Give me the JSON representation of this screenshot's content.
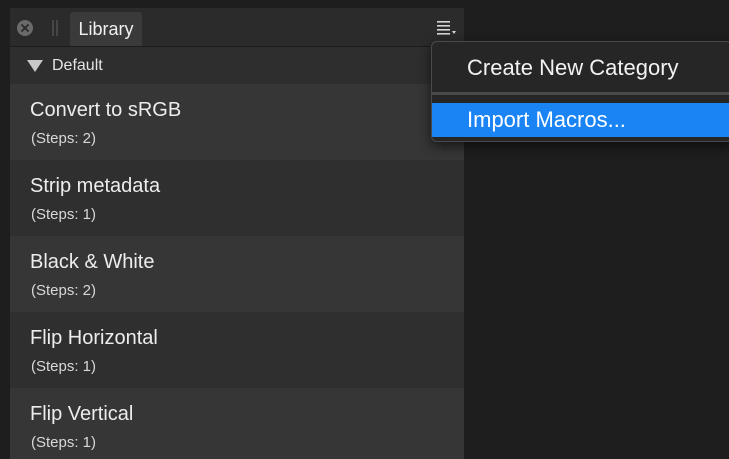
{
  "panel": {
    "tab_label": "Library",
    "category": "Default",
    "macros": [
      {
        "name": "Convert to sRGB",
        "steps": "(Steps: 2)"
      },
      {
        "name": "Strip metadata",
        "steps": "(Steps: 1)"
      },
      {
        "name": "Black & White",
        "steps": "(Steps: 2)"
      },
      {
        "name": "Flip Horizontal",
        "steps": "(Steps: 1)"
      },
      {
        "name": "Flip Vertical",
        "steps": "(Steps: 1)"
      }
    ]
  },
  "menu": {
    "items": [
      {
        "label": "Create New Category"
      },
      {
        "label": "Import Macros..."
      }
    ],
    "highlighted_color": "#1a84f5"
  },
  "icons": {
    "close": "close-icon",
    "grip": "grip-icon",
    "menu": "hamburger-menu-icon",
    "expand": "disclosure-triangle-icon"
  }
}
